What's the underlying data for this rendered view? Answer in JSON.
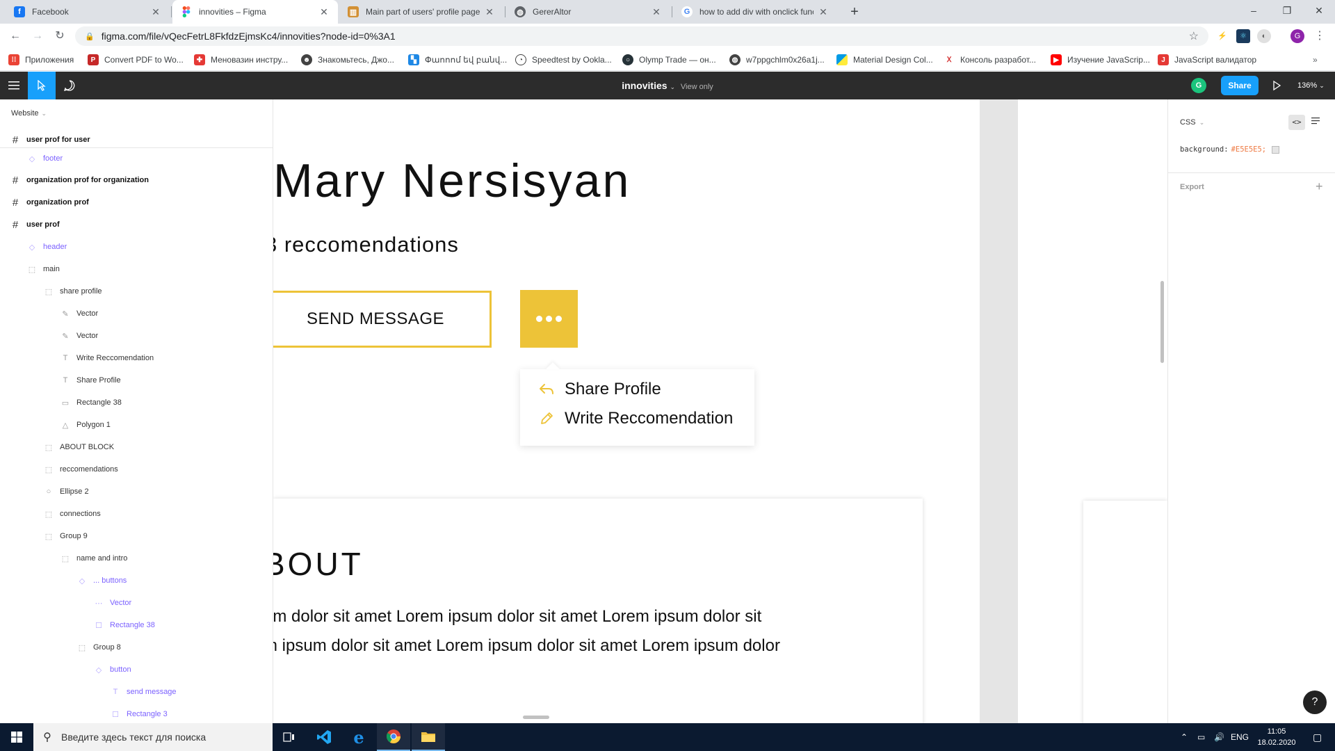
{
  "browser": {
    "tabs": [
      {
        "title": "Facebook",
        "favicon": "f",
        "color": "#1877f2"
      },
      {
        "title": "innovities – Figma",
        "favicon": "figma",
        "color": "#f24e1e"
      },
      {
        "title": "Main part of users' profile page c",
        "favicon": "trello",
        "color": "#d29034"
      },
      {
        "title": "GererAltor",
        "favicon": "globe",
        "color": "#5f6368"
      },
      {
        "title": "how to add div with onclick funct",
        "favicon": "G",
        "color": "#4285f4"
      }
    ],
    "url": "figma.com/file/vQecFetrL8FkfdzEjmsKc4/innovities?node-id=0%3A1",
    "bookmarks": [
      {
        "label": "Приложения",
        "color": "#ea4335"
      },
      {
        "label": "Convert PDF to Wo...",
        "color": "#c62828"
      },
      {
        "label": "Меновазин инстру...",
        "color": "#e53935"
      },
      {
        "label": "Знакомьтесь, Джо...",
        "color": "#424242"
      },
      {
        "label": "Փաոոոմ եվ բանվ...",
        "color": "#1e88e5"
      },
      {
        "label": "Speedtest by Ookla...",
        "color": "#424242"
      },
      {
        "label": "Olymp Trade — он...",
        "color": "#263238"
      },
      {
        "label": "w7ppgchlm0x26a1j...",
        "color": "#424242"
      },
      {
        "label": "Material Design Col...",
        "color": "#039be5"
      },
      {
        "label": "Консоль разработ...",
        "color": "#d32f2f"
      },
      {
        "label": "Изучение JavaScrip...",
        "color": "#ff0000"
      },
      {
        "label": "JavaScript валидатор",
        "color": "#e53935"
      }
    ]
  },
  "figma": {
    "file_name": "innovities",
    "mode": "View only",
    "avatar": "G",
    "share_label": "Share",
    "zoom": "136%",
    "accent": "#18a0fb"
  },
  "layers": {
    "page": "Website",
    "items": [
      {
        "label": "user prof for user",
        "kind": "frame",
        "indent": 0
      },
      {
        "label": "footer",
        "kind": "comp",
        "indent": 1
      },
      {
        "label": "organization prof for organization",
        "kind": "frame",
        "indent": 0
      },
      {
        "label": "organization prof",
        "kind": "frame",
        "indent": 0
      },
      {
        "label": "user prof",
        "kind": "frame",
        "indent": 0
      },
      {
        "label": "header",
        "kind": "comp",
        "indent": 1
      },
      {
        "label": "main",
        "kind": "group",
        "indent": 1
      },
      {
        "label": "share profile",
        "kind": "group",
        "indent": 2
      },
      {
        "label": "Vector",
        "kind": "vector",
        "indent": 3
      },
      {
        "label": "Vector",
        "kind": "vector",
        "indent": 3
      },
      {
        "label": "Write Reccomendation",
        "kind": "text",
        "indent": 3
      },
      {
        "label": "Share Profile",
        "kind": "text",
        "indent": 3
      },
      {
        "label": "Rectangle 38",
        "kind": "rect",
        "indent": 3
      },
      {
        "label": "Polygon 1",
        "kind": "polygon",
        "indent": 3
      },
      {
        "label": "ABOUT BLOCK",
        "kind": "group",
        "indent": 2
      },
      {
        "label": "reccomendations",
        "kind": "group",
        "indent": 2
      },
      {
        "label": "Ellipse 2",
        "kind": "ellipse",
        "indent": 2
      },
      {
        "label": "connections",
        "kind": "group",
        "indent": 2
      },
      {
        "label": "Group 9",
        "kind": "group",
        "indent": 2
      },
      {
        "label": "name and intro",
        "kind": "group",
        "indent": 3
      },
      {
        "label": "... buttons",
        "kind": "comp",
        "indent": 4
      },
      {
        "label": "Vector",
        "kind": "comp-vector",
        "indent": 5
      },
      {
        "label": "Rectangle 38",
        "kind": "comp-rect",
        "indent": 5
      },
      {
        "label": "Group 8",
        "kind": "group",
        "indent": 4
      },
      {
        "label": "button",
        "kind": "comp",
        "indent": 5
      },
      {
        "label": "send message",
        "kind": "comp-text",
        "indent": 6
      },
      {
        "label": "Rectangle 3",
        "kind": "comp-rect",
        "indent": 6
      }
    ]
  },
  "canvas": {
    "name": "Mary Nersisyan",
    "recommendations": "3 reccomendations",
    "send_button": "SEND MESSAGE",
    "popup": {
      "share": "Share Profile",
      "write": "Write Reccomendation"
    },
    "about_title": "BOUT",
    "about_lines": [
      "um dolor sit amet Lorem ipsum dolor sit amet Lorem ipsum dolor sit",
      "m ipsum dolor sit amet Lorem ipsum dolor sit amet Lorem ipsum dolor"
    ],
    "accent": "#edc338"
  },
  "inspect": {
    "mode": "CSS",
    "code_prop": "background:",
    "code_value": "#E5E5E5;",
    "export_label": "Export"
  },
  "taskbar": {
    "search_placeholder": "Введите здесь текст для поиска",
    "lang": "ENG",
    "time": "11:05",
    "date": "18.02.2020"
  }
}
